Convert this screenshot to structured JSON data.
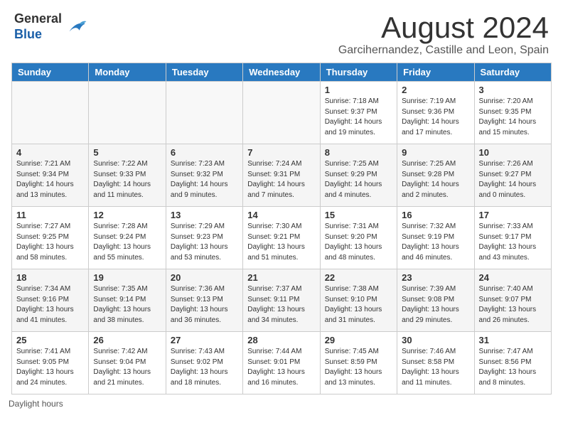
{
  "header": {
    "logo_general": "General",
    "logo_blue": "Blue",
    "month_year": "August 2024",
    "location": "Garcihernandez, Castille and Leon, Spain"
  },
  "days_of_week": [
    "Sunday",
    "Monday",
    "Tuesday",
    "Wednesday",
    "Thursday",
    "Friday",
    "Saturday"
  ],
  "weeks": [
    [
      {
        "day": "",
        "info": ""
      },
      {
        "day": "",
        "info": ""
      },
      {
        "day": "",
        "info": ""
      },
      {
        "day": "",
        "info": ""
      },
      {
        "day": "1",
        "info": "Sunrise: 7:18 AM\nSunset: 9:37 PM\nDaylight: 14 hours and 19 minutes."
      },
      {
        "day": "2",
        "info": "Sunrise: 7:19 AM\nSunset: 9:36 PM\nDaylight: 14 hours and 17 minutes."
      },
      {
        "day": "3",
        "info": "Sunrise: 7:20 AM\nSunset: 9:35 PM\nDaylight: 14 hours and 15 minutes."
      }
    ],
    [
      {
        "day": "4",
        "info": "Sunrise: 7:21 AM\nSunset: 9:34 PM\nDaylight: 14 hours and 13 minutes."
      },
      {
        "day": "5",
        "info": "Sunrise: 7:22 AM\nSunset: 9:33 PM\nDaylight: 14 hours and 11 minutes."
      },
      {
        "day": "6",
        "info": "Sunrise: 7:23 AM\nSunset: 9:32 PM\nDaylight: 14 hours and 9 minutes."
      },
      {
        "day": "7",
        "info": "Sunrise: 7:24 AM\nSunset: 9:31 PM\nDaylight: 14 hours and 7 minutes."
      },
      {
        "day": "8",
        "info": "Sunrise: 7:25 AM\nSunset: 9:29 PM\nDaylight: 14 hours and 4 minutes."
      },
      {
        "day": "9",
        "info": "Sunrise: 7:25 AM\nSunset: 9:28 PM\nDaylight: 14 hours and 2 minutes."
      },
      {
        "day": "10",
        "info": "Sunrise: 7:26 AM\nSunset: 9:27 PM\nDaylight: 14 hours and 0 minutes."
      }
    ],
    [
      {
        "day": "11",
        "info": "Sunrise: 7:27 AM\nSunset: 9:25 PM\nDaylight: 13 hours and 58 minutes."
      },
      {
        "day": "12",
        "info": "Sunrise: 7:28 AM\nSunset: 9:24 PM\nDaylight: 13 hours and 55 minutes."
      },
      {
        "day": "13",
        "info": "Sunrise: 7:29 AM\nSunset: 9:23 PM\nDaylight: 13 hours and 53 minutes."
      },
      {
        "day": "14",
        "info": "Sunrise: 7:30 AM\nSunset: 9:21 PM\nDaylight: 13 hours and 51 minutes."
      },
      {
        "day": "15",
        "info": "Sunrise: 7:31 AM\nSunset: 9:20 PM\nDaylight: 13 hours and 48 minutes."
      },
      {
        "day": "16",
        "info": "Sunrise: 7:32 AM\nSunset: 9:19 PM\nDaylight: 13 hours and 46 minutes."
      },
      {
        "day": "17",
        "info": "Sunrise: 7:33 AM\nSunset: 9:17 PM\nDaylight: 13 hours and 43 minutes."
      }
    ],
    [
      {
        "day": "18",
        "info": "Sunrise: 7:34 AM\nSunset: 9:16 PM\nDaylight: 13 hours and 41 minutes."
      },
      {
        "day": "19",
        "info": "Sunrise: 7:35 AM\nSunset: 9:14 PM\nDaylight: 13 hours and 38 minutes."
      },
      {
        "day": "20",
        "info": "Sunrise: 7:36 AM\nSunset: 9:13 PM\nDaylight: 13 hours and 36 minutes."
      },
      {
        "day": "21",
        "info": "Sunrise: 7:37 AM\nSunset: 9:11 PM\nDaylight: 13 hours and 34 minutes."
      },
      {
        "day": "22",
        "info": "Sunrise: 7:38 AM\nSunset: 9:10 PM\nDaylight: 13 hours and 31 minutes."
      },
      {
        "day": "23",
        "info": "Sunrise: 7:39 AM\nSunset: 9:08 PM\nDaylight: 13 hours and 29 minutes."
      },
      {
        "day": "24",
        "info": "Sunrise: 7:40 AM\nSunset: 9:07 PM\nDaylight: 13 hours and 26 minutes."
      }
    ],
    [
      {
        "day": "25",
        "info": "Sunrise: 7:41 AM\nSunset: 9:05 PM\nDaylight: 13 hours and 24 minutes."
      },
      {
        "day": "26",
        "info": "Sunrise: 7:42 AM\nSunset: 9:04 PM\nDaylight: 13 hours and 21 minutes."
      },
      {
        "day": "27",
        "info": "Sunrise: 7:43 AM\nSunset: 9:02 PM\nDaylight: 13 hours and 18 minutes."
      },
      {
        "day": "28",
        "info": "Sunrise: 7:44 AM\nSunset: 9:01 PM\nDaylight: 13 hours and 16 minutes."
      },
      {
        "day": "29",
        "info": "Sunrise: 7:45 AM\nSunset: 8:59 PM\nDaylight: 13 hours and 13 minutes."
      },
      {
        "day": "30",
        "info": "Sunrise: 7:46 AM\nSunset: 8:58 PM\nDaylight: 13 hours and 11 minutes."
      },
      {
        "day": "31",
        "info": "Sunrise: 7:47 AM\nSunset: 8:56 PM\nDaylight: 13 hours and 8 minutes."
      }
    ]
  ],
  "footer": {
    "daylight_label": "Daylight hours"
  }
}
